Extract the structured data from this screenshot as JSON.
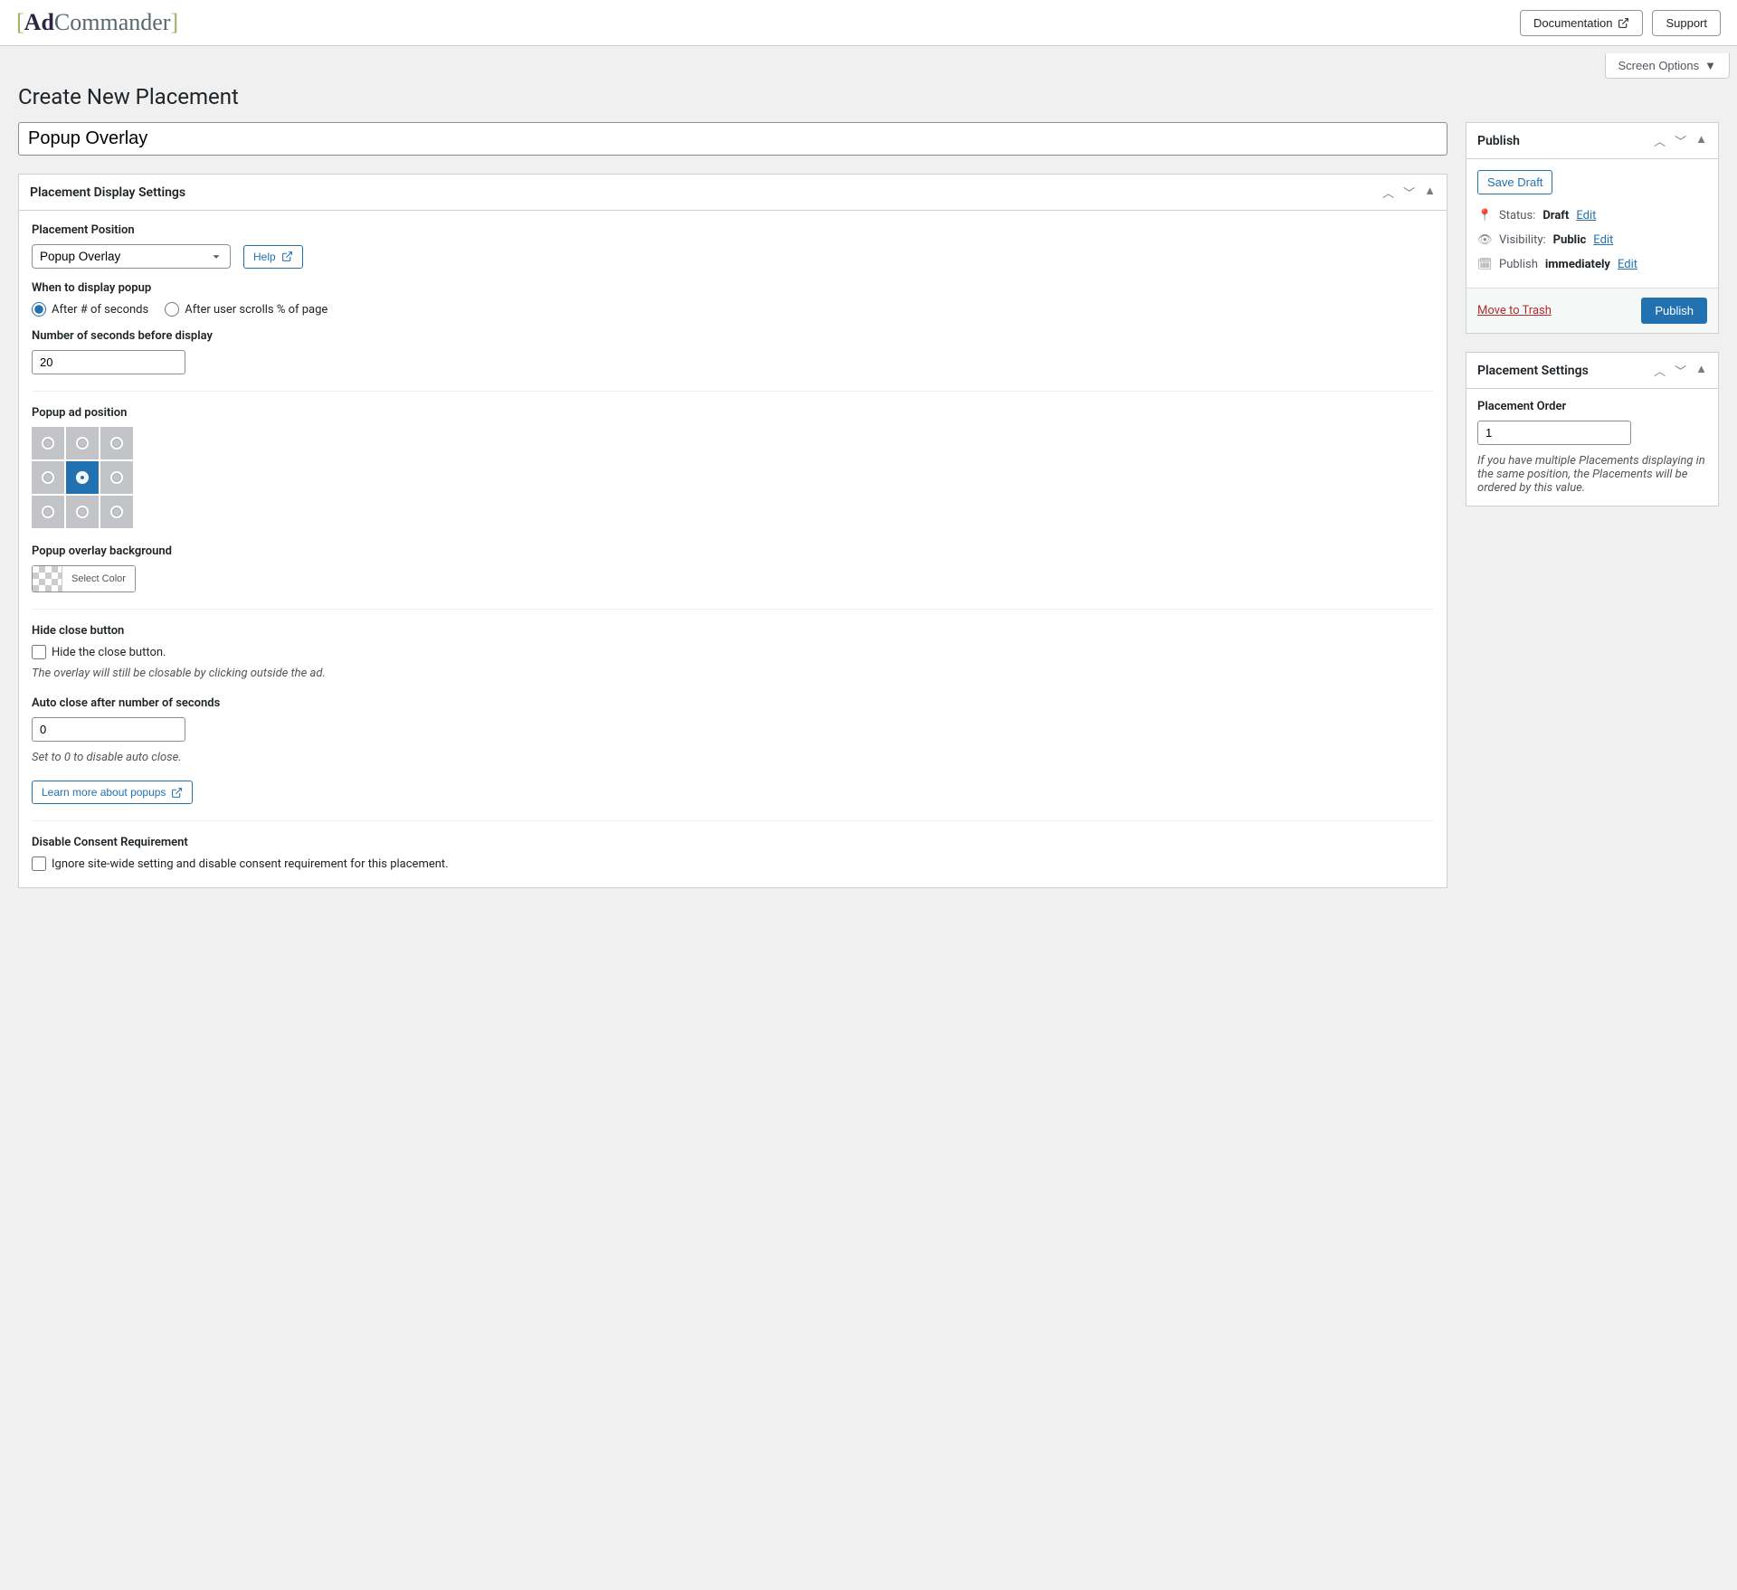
{
  "brand": {
    "ad": "Ad",
    "rest": "Commander"
  },
  "top": {
    "doc": "Documentation",
    "support": "Support"
  },
  "screen_options": "Screen Options",
  "page_title": "Create New Placement",
  "title_value": "Popup Overlay",
  "box_display": {
    "title": "Placement Display Settings",
    "position_label": "Placement Position",
    "position_value": "Popup Overlay",
    "help": "Help",
    "when_label": "When to display popup",
    "when_options": {
      "seconds": "After # of seconds",
      "scroll": "After user scrolls % of page"
    },
    "seconds_label": "Number of seconds before display",
    "seconds_value": "20",
    "adpos_label": "Popup ad position",
    "adpos_selected_index": 4,
    "bg_label": "Popup overlay background",
    "select_color": "Select Color",
    "hide_close_label": "Hide close button",
    "hide_close_cb": "Hide the close button.",
    "hide_close_note": "The overlay will still be closable by clicking outside the ad.",
    "autoclose_label": "Auto close after number of seconds",
    "autoclose_value": "0",
    "autoclose_note": "Set to 0 to disable auto close.",
    "learn_more": "Learn more about popups",
    "consent_label": "Disable Consent Requirement",
    "consent_cb": "Ignore site-wide setting and disable consent requirement for this placement."
  },
  "publish": {
    "title": "Publish",
    "save_draft": "Save Draft",
    "status_label": "Status:",
    "status_value": "Draft",
    "visibility_label": "Visibility:",
    "visibility_value": "Public",
    "publish_label": "Publish",
    "publish_value": "immediately",
    "edit": "Edit",
    "trash": "Move to Trash",
    "publish_btn": "Publish"
  },
  "settings": {
    "title": "Placement Settings",
    "order_label": "Placement Order",
    "order_value": "1",
    "order_note": "If you have multiple Placements displaying in the same position, the Placements will be ordered by this value."
  }
}
